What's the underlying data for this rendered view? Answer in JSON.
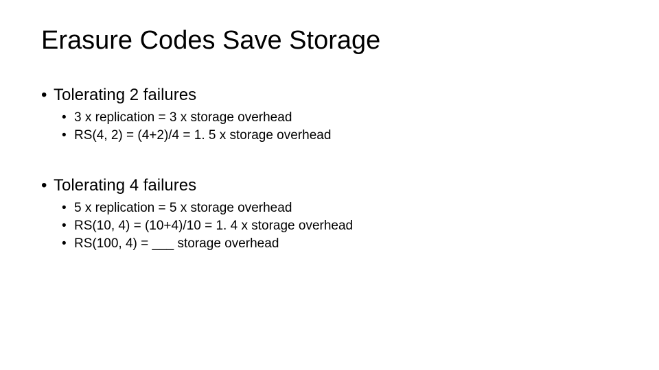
{
  "title": "Erasure Codes Save Storage",
  "groups": [
    {
      "heading": "Tolerating 2 failures",
      "items": [
        "3 x replication = 3 x storage overhead",
        "RS(4, 2) = (4+2)/4 = 1. 5 x storage overhead"
      ]
    },
    {
      "heading": "Tolerating 4 failures",
      "items": [
        "5 x replication = 5 x storage overhead",
        "RS(10, 4) = (10+4)/10 = 1. 4 x storage overhead",
        "RS(100, 4) = ___ storage overhead"
      ]
    }
  ]
}
